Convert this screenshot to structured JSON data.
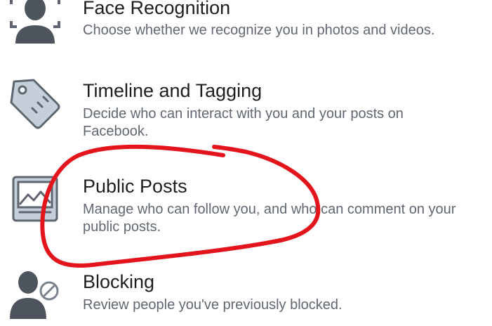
{
  "settings": {
    "items": [
      {
        "icon": "face-recognition-icon",
        "title": "Face Recognition",
        "description": "Choose whether we recognize you in photos and videos."
      },
      {
        "icon": "tag-icon",
        "title": "Timeline and Tagging",
        "description": "Decide who can interact with you and your posts on Facebook."
      },
      {
        "icon": "public-posts-icon",
        "title": "Public Posts",
        "description": "Manage who can follow you, and who can comment on your public posts."
      },
      {
        "icon": "blocking-icon",
        "title": "Blocking",
        "description": "Review people you've previously blocked."
      }
    ]
  },
  "colors": {
    "title": "#1c1e21",
    "description": "#606770",
    "icon_gray": "#5f6570",
    "icon_light": "#c4cfd9",
    "annotation": "#e3141b"
  }
}
